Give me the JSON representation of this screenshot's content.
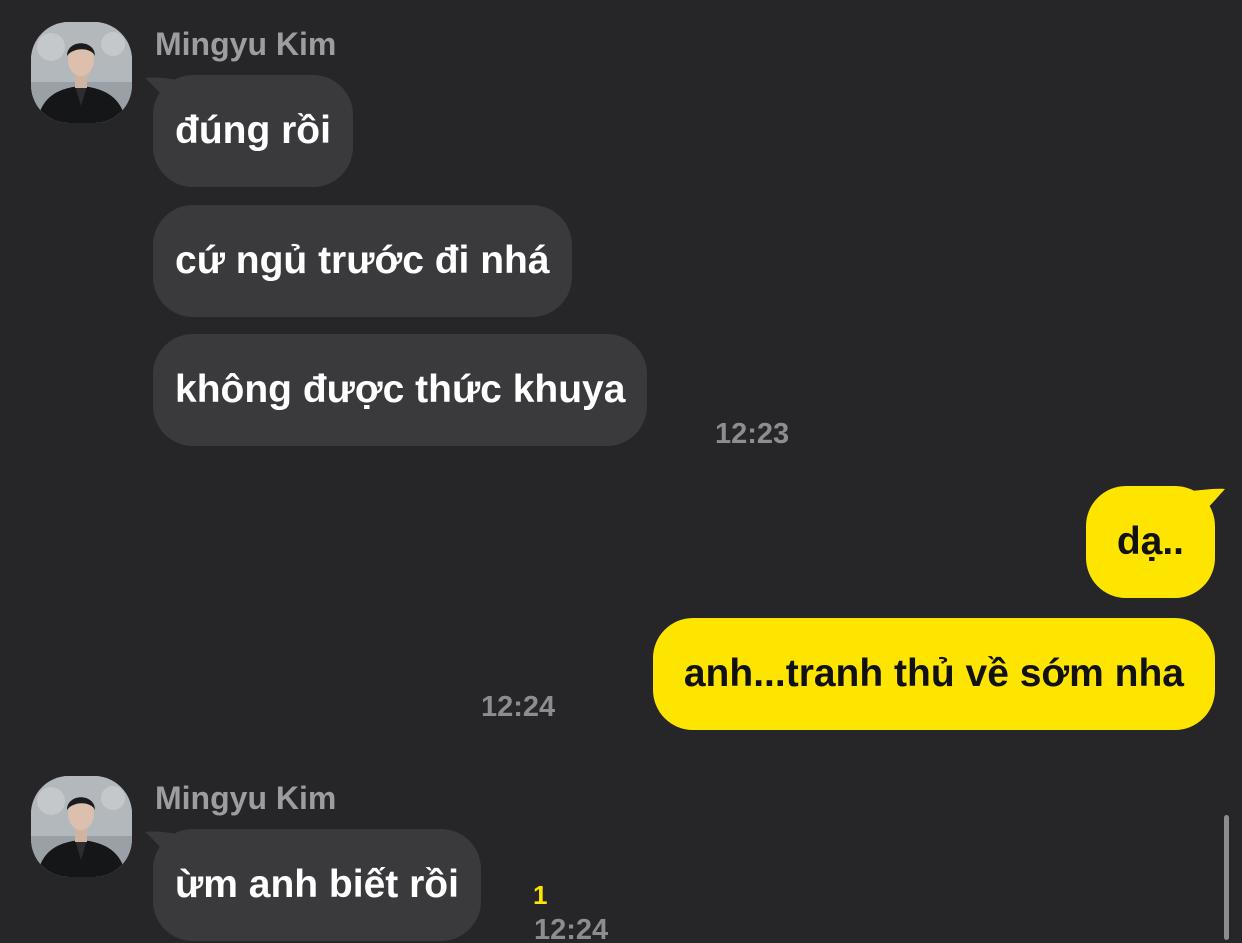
{
  "messages": [
    {
      "sender": "Mingyu Kim",
      "avatar_icon": "profile-photo",
      "bubbles": [
        "đúng rồi",
        "cứ ngủ trước đi nhá",
        "không được thức khuya"
      ],
      "time": "12:23"
    },
    {
      "outgoing": true,
      "bubbles": [
        "dạ..",
        "anh...tranh thủ về sớm nha"
      ],
      "time": "12:24"
    },
    {
      "sender": "Mingyu Kim",
      "avatar_icon": "profile-photo",
      "bubbles": [
        "ừm anh biết rồi"
      ],
      "unread_count": "1",
      "time": "12:24"
    }
  ],
  "colors": {
    "background": "#262628",
    "incoming_bubble": "#3a3a3d",
    "outgoing_bubble": "#fee500",
    "unread": "#fee500"
  }
}
